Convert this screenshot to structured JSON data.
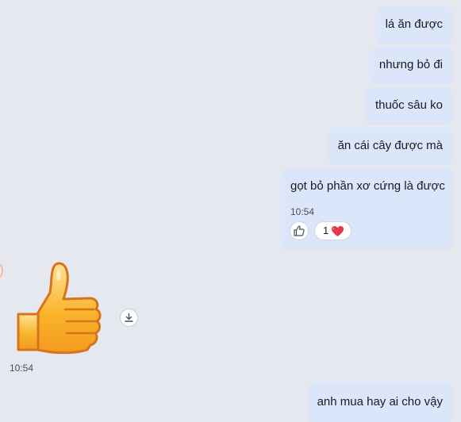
{
  "messages_out": [
    {
      "text": "lá ăn được"
    },
    {
      "text": "nhưng bỏ đi"
    },
    {
      "text": "thuốc sâu ko"
    },
    {
      "text": "ăn cái cây được mà"
    },
    {
      "text": "gọt bỏ phần xơ cứng là được",
      "time": "10:54",
      "reactions": {
        "like_icon": "thumbs-up-outline-icon",
        "count": "1",
        "emoji": "heart-icon",
        "emoji_color": "#e3364f"
      }
    },
    {
      "text": "anh mua hay ai cho vậy"
    }
  ],
  "incoming": {
    "sticker": "thumbs-up-sticker",
    "time": "10:54",
    "download_icon": "download-icon"
  },
  "colors": {
    "background": "#e5e8ee",
    "outgoing_bubble": "#dbe6fb",
    "sticker_fill": "#f9b52b",
    "sticker_outline": "#d8731c"
  }
}
